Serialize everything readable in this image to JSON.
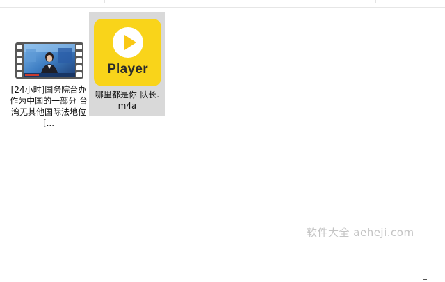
{
  "files": [
    {
      "name": "[24小时]国务院台办 作为中国的一部分 台湾无其他国际法地位[...",
      "type": "video",
      "icon": "video-file-icon",
      "selected": false
    },
    {
      "name": "哪里都是你-队长.m4a",
      "type": "audio",
      "icon": "player-app-icon",
      "icon_text": "Player",
      "selected": true
    }
  ],
  "watermark": "软件大全 aeheji.com",
  "colors": {
    "player_yellow": "#f9d41a",
    "selection_bg": "#d9d9d9",
    "film_blue": "#2c5a9b"
  }
}
